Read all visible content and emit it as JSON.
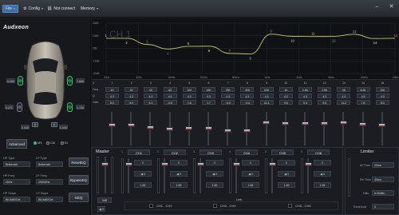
{
  "topbar": {
    "menus": [
      "File",
      "Config",
      "Not connect",
      "Memory"
    ],
    "window_controls": [
      "minimize-icon",
      "close-icon"
    ]
  },
  "brand": {
    "logo": "Audxeon"
  },
  "left": {
    "channel_badges": [
      "0.000",
      "7.600",
      "0.271",
      "1.720",
      "0.000",
      "0.000"
    ],
    "advanced_label": "Advanced",
    "radios": [
      "MS",
      "CM",
      "IN"
    ],
    "radio_selected": 0
  },
  "graph": {
    "y_labels": [
      "20dB",
      "10dB",
      "0dB",
      "-10dB",
      "-20dB"
    ],
    "x_labels": [
      "20Hz",
      "50Hz",
      "100Hz",
      "200Hz",
      "500Hz",
      "1kHz",
      "2kHz",
      "5kHz",
      "10kHz",
      "20kHz"
    ],
    "overlay_title": "CH 1",
    "point_labels": [
      "1",
      "2",
      "3",
      "4",
      "5",
      "6",
      "7",
      "8",
      "9",
      "10",
      "11",
      "12",
      "13",
      "14",
      "15"
    ],
    "point_colors": [
      "#e0e0e0",
      "#e0e0e0",
      "#4caf50",
      "#5b7fe0",
      "#e0e0e0",
      "#e0e0e0",
      "#d9a441",
      "#b0b0b0",
      "#5b9ce0",
      "#c8c8c8",
      "#c8d040",
      "#5bd05b",
      "#5bc4e0",
      "#e0e0e0",
      "#e05b9c"
    ],
    "curve_color": "#c8c86a"
  },
  "eq": {
    "row_labels": [
      "Freq",
      "Q",
      "Gain"
    ],
    "band_numbers": [
      "1",
      "2",
      "3",
      "4",
      "5",
      "6",
      "7",
      "8",
      "9",
      "10",
      "11",
      "12",
      "13",
      "14",
      "15"
    ],
    "freq": [
      "20",
      "32",
      "40",
      "63",
      "100",
      "160",
      "250",
      "400",
      "630",
      "1K",
      "1.6K",
      "2.5K",
      "4K",
      "6.3K",
      "10K"
    ],
    "q": [
      "4.3",
      "4.3",
      "4.3",
      "4.3",
      "4.3",
      "4.3",
      "4.3",
      "4.3",
      "4.3",
      "4.3",
      "4.3",
      "4.3",
      "4.3",
      "4.3",
      "4.3"
    ],
    "gain": [
      "8.0",
      "8.0",
      "3.1",
      "-0.5",
      "1.6",
      "1.7",
      "-4.0",
      "-4.4",
      "11.3",
      "9.6",
      "9.4",
      "9.5",
      "11.2",
      "7.8",
      "8.0"
    ],
    "slider_levels": [
      0.62,
      0.62,
      0.55,
      0.49,
      0.52,
      0.52,
      0.44,
      0.43,
      0.7,
      0.67,
      0.67,
      0.67,
      0.7,
      0.64,
      0.62
    ]
  },
  "crossover": {
    "hp_type_label": "HP Type",
    "hp_type_value": "Butterwth",
    "lp_type_label": "LP Type",
    "lp_type_value": "Butterwth",
    "hp_freq_label": "HP Freq",
    "hp_freq_value": "20Hz",
    "lp_freq_label": "LP Freq",
    "lp_freq_value": "20000Hz",
    "hp_slope_label": "HP Slope",
    "hp_slope_value": "Bit-6dB/Oct",
    "lp_slope_label": "LP Slope",
    "lp_slope_value": "Bit-6dB/Oct",
    "buttons": [
      "ResetEQ",
      "BypassEQ",
      "GEQ"
    ]
  },
  "mixer": {
    "master_title": "Master",
    "master_value": "0dB",
    "master_btn": "0",
    "channels": [
      {
        "num": "1",
        "name": "CH1",
        "delay": "0",
        "phase": "0",
        "value": "1.85"
      },
      {
        "num": "2",
        "name": "CH2",
        "delay": "0",
        "phase": "0",
        "value": "1.85"
      },
      {
        "num": "3",
        "name": "CH3",
        "delay": "0",
        "phase": "0",
        "value": "1.85"
      },
      {
        "num": "4",
        "name": "CH4",
        "delay": "0",
        "phase": "0",
        "value": "1.85"
      },
      {
        "num": "5",
        "name": "CH5",
        "delay": "0",
        "phase": "0",
        "value": "1.85"
      },
      {
        "num": "6",
        "name": "CH6",
        "delay": "0",
        "phase": "0",
        "value": "1.85"
      }
    ],
    "link_title": "Link",
    "link_groups": [
      "CH1 - CH2",
      "CH3 - CH4",
      "CH5 - CH6"
    ]
  },
  "limiter": {
    "title": "Limiter",
    "at_time_label": "At Time",
    "at_time_value": "20ms",
    "re_time_label": "Re Time",
    "re_time_value": "40ms",
    "db_label": "DBu",
    "db_value": "6.00dBu",
    "threshold_label": "Threshold",
    "threshold_value": "0"
  }
}
